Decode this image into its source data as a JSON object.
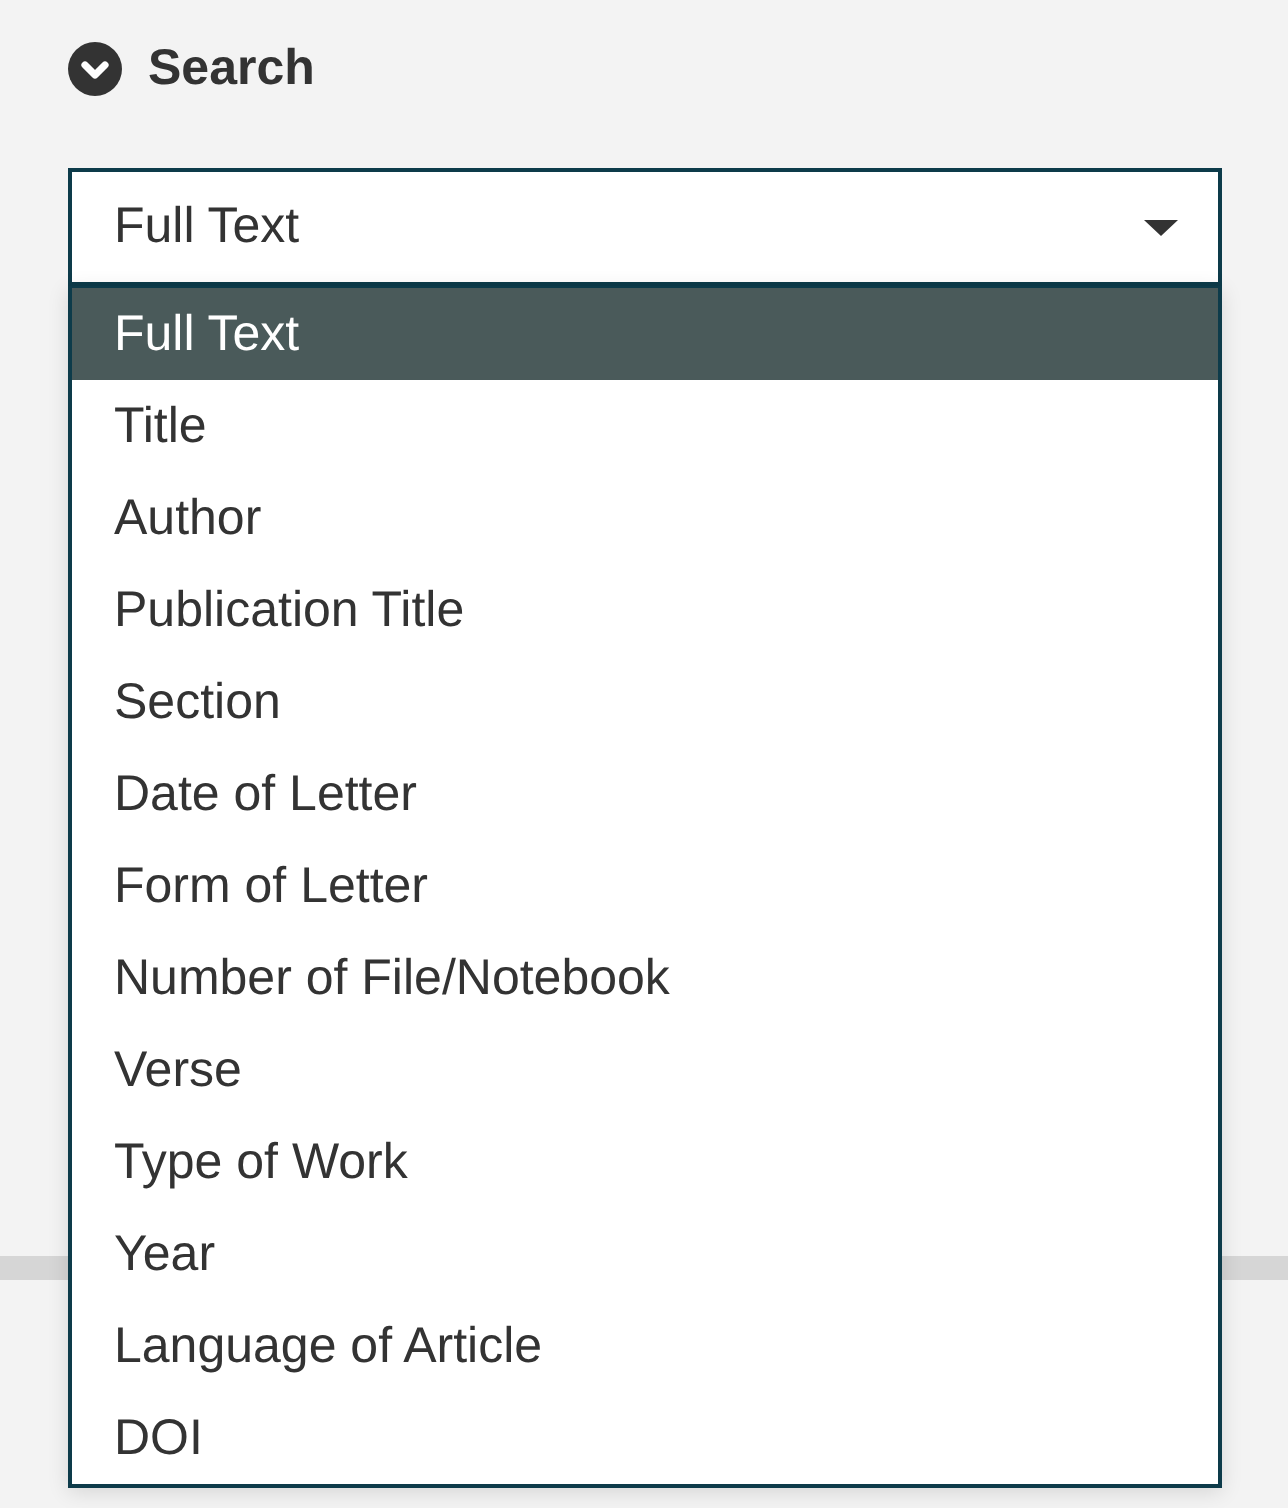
{
  "section": {
    "title": "Search",
    "expanded": true
  },
  "select": {
    "value": "Full Text",
    "open": true
  },
  "options": [
    {
      "label": "Full Text",
      "selected": true
    },
    {
      "label": "Title",
      "selected": false
    },
    {
      "label": "Author",
      "selected": false
    },
    {
      "label": "Publication Title",
      "selected": false
    },
    {
      "label": "Section",
      "selected": false
    },
    {
      "label": "Date of Letter",
      "selected": false
    },
    {
      "label": "Form of Letter",
      "selected": false
    },
    {
      "label": "Number of File/Notebook",
      "selected": false
    },
    {
      "label": "Verse",
      "selected": false
    },
    {
      "label": "Type of Work",
      "selected": false
    },
    {
      "label": "Year",
      "selected": false
    },
    {
      "label": "Language of Article",
      "selected": false
    },
    {
      "label": "DOI",
      "selected": false
    }
  ]
}
